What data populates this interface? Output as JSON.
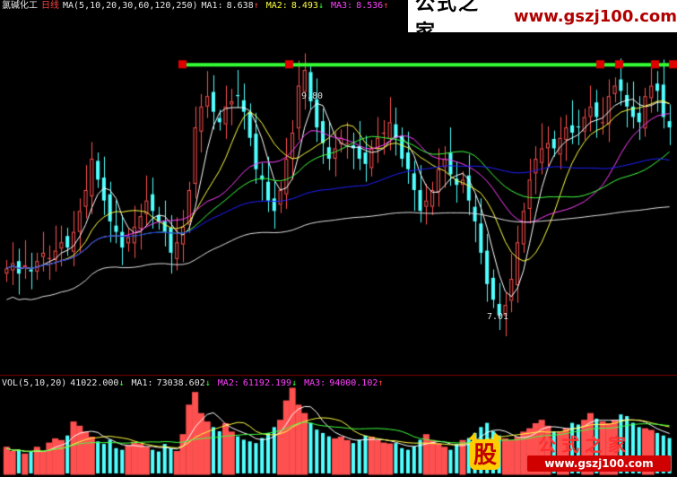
{
  "header": {
    "stock_name": "氯碱化工",
    "period": "日线",
    "ma_def": "MA(5,10,20,30,60,120,250)",
    "ma1_label": "MA1:",
    "ma1_value": "8.638",
    "ma1_arrow": "↑",
    "ma2_label": "MA2:",
    "ma2_value": "8.493",
    "ma2_arrow": "↓",
    "ma3_label": "MA3:",
    "ma3_value": "8.536",
    "ma3_arrow": "↑"
  },
  "price_labels": {
    "high": "9.80",
    "low": "7.01"
  },
  "volume_header": {
    "name": "VOL(5,10,20)",
    "vol_value": "41022.000",
    "vol_arrow": "↓",
    "ma1_label": "MA1:",
    "ma1_value": "73038.602",
    "ma1_arrow": "↓",
    "ma2_label": "MA2:",
    "ma2_value": "61192.199",
    "ma2_arrow": "↓",
    "ma3_label": "MA3:",
    "ma3_value": "94000.102",
    "ma3_arrow": "↑"
  },
  "watermark_top": {
    "cn": "公式之家",
    "url": "www.gszj100.com"
  },
  "watermark_bottom": {
    "logo_char": "股",
    "cn": "公式之家",
    "url": "www.gszj100.com"
  },
  "colors": {
    "up": "#ff5050",
    "down": "#50ffff",
    "resistance": "#33ff33",
    "ma1": "#ffffff",
    "ma2": "#ffff40",
    "ma3": "#ff40ff",
    "ma_green": "#40ff40",
    "ma_blue": "#2020ff",
    "ma_long": "#e0e0e0"
  },
  "chart_data": {
    "type": "candlestick",
    "ylim": [
      6.6,
      10.0
    ],
    "resistance_level": 9.5,
    "closes": [
      7.55,
      7.6,
      7.5,
      7.58,
      7.52,
      7.62,
      7.7,
      7.65,
      7.72,
      7.8,
      7.75,
      7.9,
      8.1,
      8.3,
      8.6,
      8.4,
      8.2,
      8.0,
      7.9,
      7.75,
      7.85,
      7.95,
      8.05,
      8.2,
      8.1,
      8.0,
      7.9,
      7.7,
      7.8,
      7.95,
      8.3,
      8.9,
      9.1,
      9.2,
      9.05,
      8.95,
      9.1,
      9.15,
      9.2,
      9.05,
      8.8,
      8.5,
      8.4,
      8.2,
      8.1,
      8.3,
      8.6,
      8.85,
      9.3,
      9.45,
      9.15,
      8.9,
      8.75,
      8.6,
      8.7,
      8.8,
      8.75,
      8.7,
      8.6,
      8.55,
      8.7,
      8.8,
      8.85,
      8.95,
      8.8,
      8.6,
      8.5,
      8.3,
      8.1,
      8.2,
      8.3,
      8.5,
      8.6,
      8.45,
      8.35,
      8.4,
      8.2,
      8.0,
      7.7,
      7.4,
      7.25,
      7.1,
      7.2,
      7.45,
      7.8,
      8.1,
      8.4,
      8.6,
      8.7,
      8.75,
      8.7,
      8.8,
      8.9,
      8.85,
      8.9,
      9.0,
      9.1,
      9.0,
      8.95,
      9.2,
      9.3,
      9.25,
      9.1,
      9.0,
      8.95,
      9.2,
      9.3,
      9.25,
      9.0,
      8.9
    ],
    "volumes": [
      30,
      25,
      28,
      22,
      26,
      30,
      24,
      35,
      40,
      38,
      45,
      60,
      55,
      48,
      42,
      38,
      35,
      40,
      30,
      28,
      32,
      36,
      34,
      30,
      28,
      26,
      35,
      30,
      25,
      45,
      80,
      95,
      70,
      60,
      55,
      50,
      58,
      48,
      44,
      40,
      38,
      36,
      42,
      48,
      55,
      62,
      85,
      100,
      80,
      70,
      60,
      52,
      48,
      44,
      40,
      42,
      38,
      36,
      40,
      45,
      42,
      38,
      35,
      34,
      36,
      30,
      28,
      32,
      40,
      45,
      38,
      34,
      30,
      28,
      35,
      38,
      42,
      48,
      55,
      60,
      50,
      45,
      40,
      38,
      42,
      48,
      52,
      58,
      62,
      55,
      50,
      48,
      52,
      60,
      58,
      62,
      70,
      65,
      60,
      58,
      62,
      70,
      68,
      60,
      55,
      52,
      50,
      48,
      45,
      42
    ]
  }
}
